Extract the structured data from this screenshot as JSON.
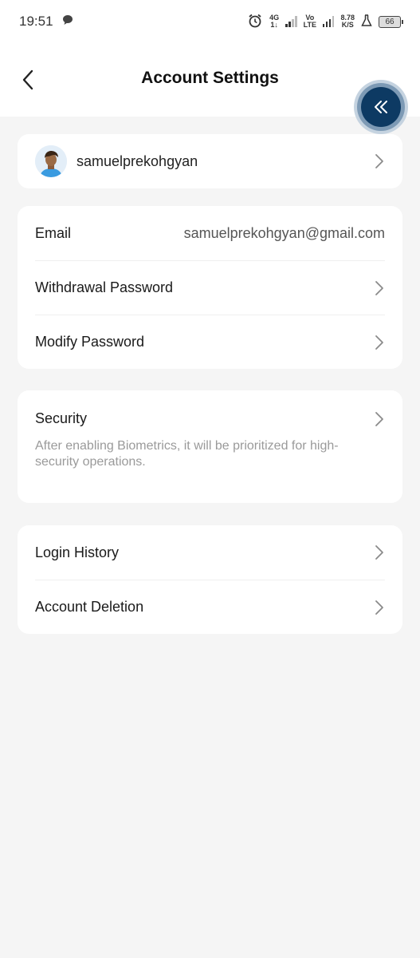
{
  "status_bar": {
    "time": "19:51",
    "network_top": "4G",
    "network_bottom": "1↓",
    "volte_top": "Vo",
    "volte_bottom": "LTE",
    "speed_top": "8.78",
    "speed_bottom": "K/S",
    "battery": "66",
    "icons": [
      "chat-bubble-icon",
      "alarm-icon",
      "signal-icon",
      "flask-icon",
      "battery-icon"
    ]
  },
  "header": {
    "title": "Account Settings",
    "back_icon": "chevron-left-icon"
  },
  "fab": {
    "icon": "double-chevron-left-icon",
    "color": "#0d3a63"
  },
  "profile": {
    "username": "samuelprekohgyan"
  },
  "account_card": {
    "email_label": "Email",
    "email_value": "samuelprekohgyan@gmail.com",
    "withdrawal_label": "Withdrawal Password",
    "modify_label": "Modify Password"
  },
  "security": {
    "label": "Security",
    "description": "After enabling Biometrics, it will be prioritized for high-security operations."
  },
  "history_card": {
    "login_history_label": "Login History",
    "account_deletion_label": "Account Deletion"
  },
  "colors": {
    "background": "#f5f5f5",
    "card": "#ffffff",
    "accent": "#0d3a63"
  }
}
